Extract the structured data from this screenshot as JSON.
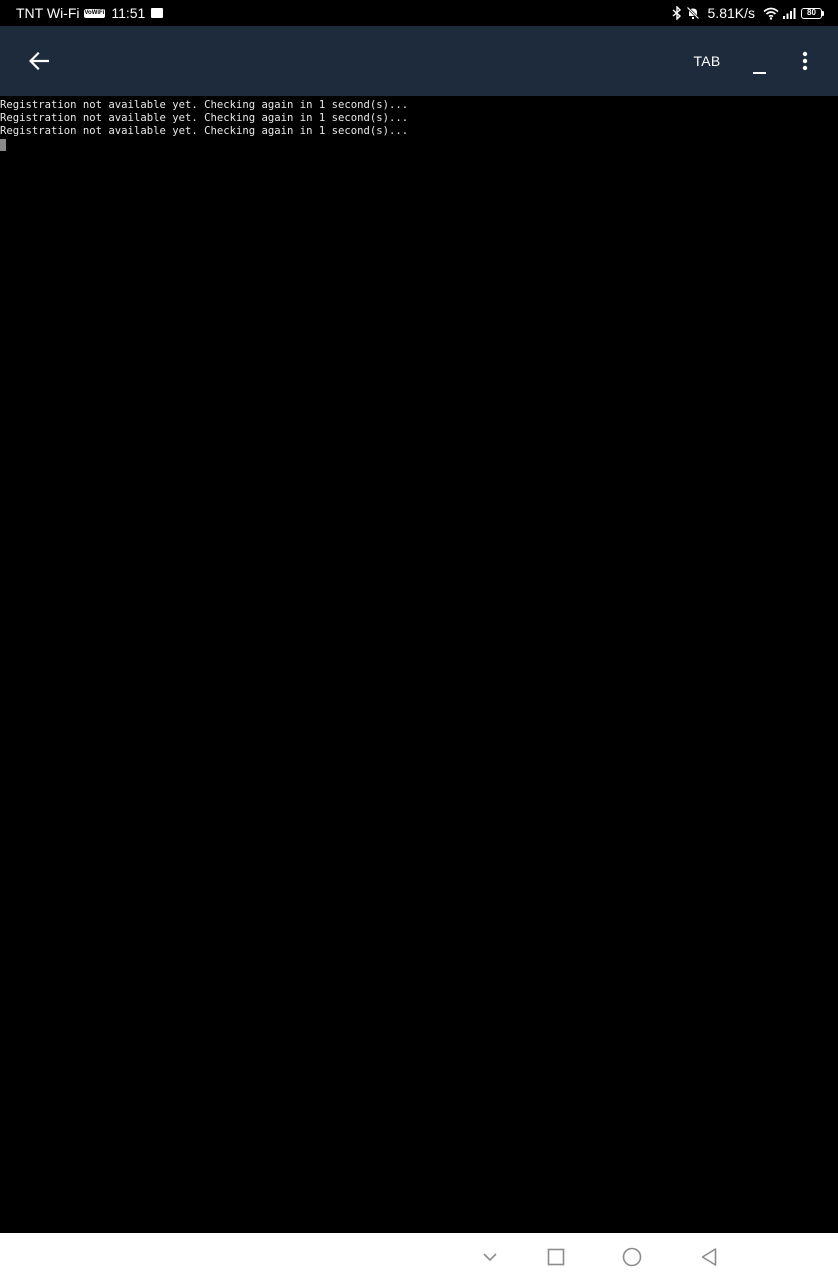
{
  "status_bar": {
    "carrier": "TNT Wi-Fi",
    "wifi_badge": "VoWiFi",
    "time": "11:51",
    "net_speed": "5.81K/s",
    "battery_level": "80",
    "icons": [
      "bluetooth-icon",
      "mute-bell-icon",
      "wifi-icon",
      "signal-icon",
      "battery-icon"
    ]
  },
  "toolbar": {
    "background": "#1e2b3d",
    "tab_label": "TAB",
    "icons": [
      "back-arrow-icon",
      "underscore-icon",
      "more-vert-icon"
    ]
  },
  "terminal": {
    "lines": [
      "Registration not available yet. Checking again in 1 second(s)...",
      "Registration not available yet. Checking again in 1 second(s)...",
      "Registration not available yet. Checking again in 1 second(s)..."
    ]
  },
  "nav_bar": {
    "icons": [
      "chevron-down-icon",
      "recents-square-icon",
      "home-circle-icon",
      "back-triangle-icon"
    ]
  }
}
